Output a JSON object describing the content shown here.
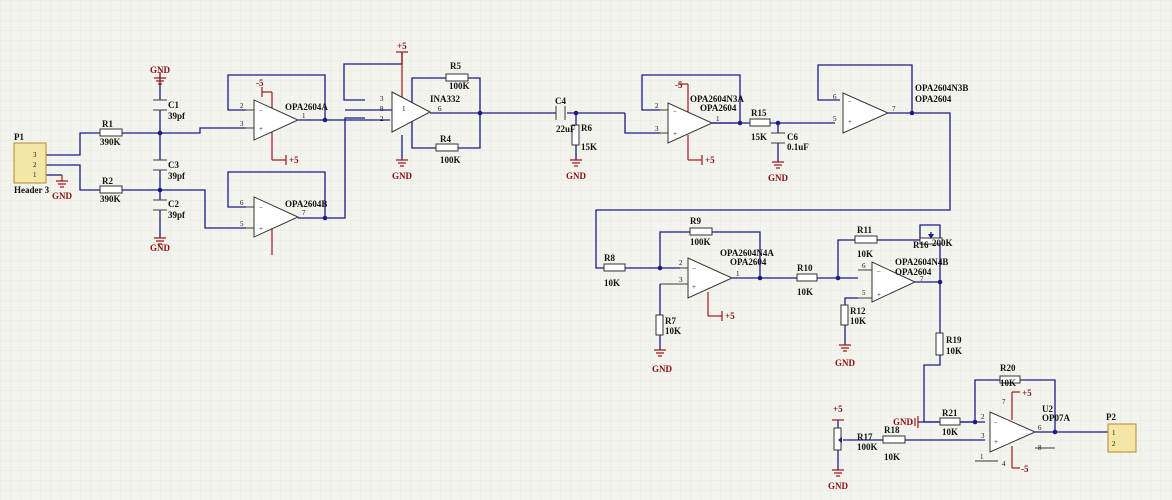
{
  "connectors": [
    {
      "id": "p1",
      "ref": "P1",
      "name": "Header 3",
      "pins": [
        "3",
        "2",
        "1"
      ]
    },
    {
      "id": "p2",
      "ref": "P2",
      "name": "",
      "pins": [
        "1",
        "2"
      ]
    }
  ],
  "resistors": [
    {
      "id": "r1",
      "ref": "R1",
      "value": "390K"
    },
    {
      "id": "r2",
      "ref": "R2",
      "value": "390K"
    },
    {
      "id": "r5",
      "ref": "R5",
      "value": "100K"
    },
    {
      "id": "r4",
      "ref": "R4",
      "value": "100K"
    },
    {
      "id": "r6",
      "ref": "R6",
      "value": "15K"
    },
    {
      "id": "r15",
      "ref": "R15",
      "value": "15K"
    },
    {
      "id": "r9",
      "ref": "R9",
      "value": "100K"
    },
    {
      "id": "r8",
      "ref": "R8",
      "value": "10K"
    },
    {
      "id": "r7",
      "ref": "R7",
      "value": "10K"
    },
    {
      "id": "r11",
      "ref": "R11",
      "value": "10K"
    },
    {
      "id": "r10",
      "ref": "R10",
      "value": "10K"
    },
    {
      "id": "r12",
      "ref": "R12",
      "value": "10K"
    },
    {
      "id": "r19",
      "ref": "R19",
      "value": "10K"
    },
    {
      "id": "r20",
      "ref": "R20",
      "value": "10K"
    },
    {
      "id": "r21",
      "ref": "R21",
      "value": "10K"
    },
    {
      "id": "r18",
      "ref": "R18",
      "value": "10K"
    },
    {
      "id": "r16",
      "ref": "R16",
      "value": "200K"
    },
    {
      "id": "r17",
      "ref": "R17",
      "value": "100K"
    }
  ],
  "capacitors": [
    {
      "id": "c1",
      "ref": "C1",
      "value": "39pf"
    },
    {
      "id": "c3",
      "ref": "C3",
      "value": "39pf"
    },
    {
      "id": "c2",
      "ref": "C2",
      "value": "39pf"
    },
    {
      "id": "c4",
      "ref": "C4",
      "value": "22uF"
    },
    {
      "id": "c6",
      "ref": "C6",
      "value": "0.1uF"
    }
  ],
  "amplifiers": [
    {
      "id": "u1a",
      "ref": "OPA2604A",
      "part": ""
    },
    {
      "id": "u1b",
      "ref": "OPA2604B",
      "part": ""
    },
    {
      "id": "ina",
      "ref": "INA332",
      "part": ""
    },
    {
      "id": "u3a",
      "ref": "OPA2604N3A",
      "part": "OPA2604"
    },
    {
      "id": "u3b",
      "ref": "OPA2604N3B",
      "part": "OPA2604"
    },
    {
      "id": "u4a",
      "ref": "OPA2604N4A",
      "part": "OPA2604"
    },
    {
      "id": "u4b",
      "ref": "OPA2604N4B",
      "part": "OPA2604"
    },
    {
      "id": "u2",
      "ref": "U2",
      "part": "OP07A"
    }
  ],
  "power_labels": {
    "gnd": "GND",
    "vpos": "+5",
    "vneg": "-5"
  },
  "pin_numbers": {
    "u1a": {
      "inv": "2",
      "noninv": "3",
      "out": "1"
    },
    "u1b": {
      "inv": "6",
      "noninv": "5",
      "out": "7"
    },
    "ina": {
      "a": "3",
      "b": "8",
      "c": "1",
      "d": "2",
      "out": "6"
    },
    "u3a": {
      "inv": "2",
      "noninv": "3",
      "out": "1"
    },
    "u3b": {
      "inv": "6",
      "noninv": "5",
      "out": "7"
    },
    "u4a": {
      "inv": "2",
      "noninv": "3",
      "out": "1"
    },
    "u4b": {
      "inv": "6",
      "noninv": "5",
      "out": "7"
    },
    "u2": {
      "inv": "2",
      "noninv": "3",
      "out": "6",
      "p7": "7",
      "p4": "4",
      "p1": "1",
      "p8": "8"
    }
  },
  "colors": {
    "wire": "#1b1b8c",
    "power": "#a01818",
    "grid": "#dcdcd4",
    "background": "#f4f4ee"
  }
}
